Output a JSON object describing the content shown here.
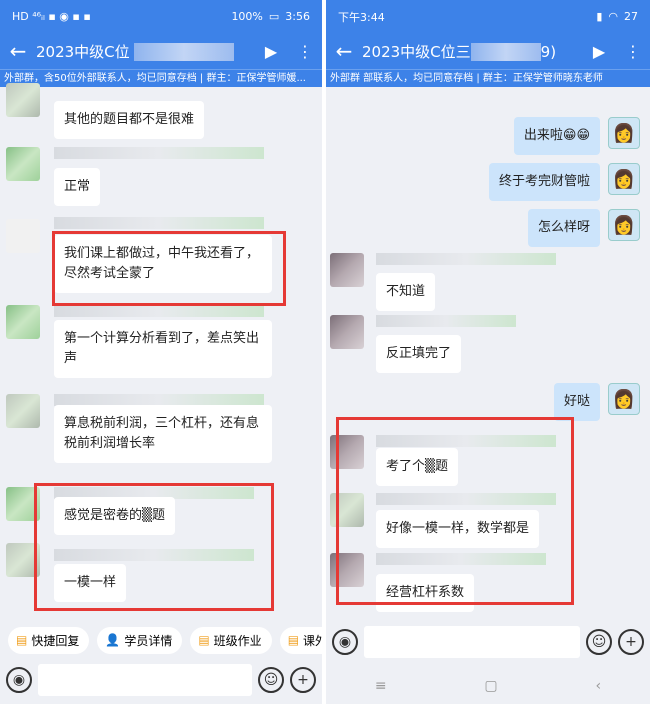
{
  "left": {
    "status": {
      "left_icons": "HD ⁴⁶ᵢₗ ▪ ◉ ▪ ▪",
      "battery": "100%",
      "time": "3:56"
    },
    "title": "2023中级C位",
    "subbar": "外部群，含50位外部联系人，均已同意存档 | 群主：正保学管师媛...",
    "messages": [
      {
        "text": "其他的题目都不是很难"
      },
      {
        "text": "正常"
      },
      {
        "text": "我们课上都做过，中午我还看了，尽然考试全蒙了"
      },
      {
        "text": "第一个计算分析看到了，差点笑出声"
      },
      {
        "text": "算息税前利润，三个杠杆，还有息税前利润增长率"
      },
      {
        "text": "感觉是密卷的▒题"
      },
      {
        "text": "一模一样"
      }
    ],
    "quick": [
      {
        "icon": "▤",
        "label": "快捷回复"
      },
      {
        "icon": "👤",
        "label": "学员详情"
      },
      {
        "icon": "▤",
        "label": "班级作业"
      },
      {
        "icon": "▤",
        "label": "课外"
      }
    ]
  },
  "right": {
    "status": {
      "time": "下午3:44",
      "battery": "27"
    },
    "title": "2023中级C位三",
    "title_suffix": "9)",
    "subbar": "外部群             部联系人，均已同意存档 | 群主：正保学管师晓东老师",
    "me_messages": [
      {
        "text": "出来啦😁😁"
      },
      {
        "text": "终于考完财管啦"
      },
      {
        "text": "怎么样呀"
      },
      {
        "text": "好哒"
      }
    ],
    "other_messages": [
      {
        "text": "不知道"
      },
      {
        "text": "反正填完了"
      },
      {
        "text": "考了个▒题"
      },
      {
        "text": "好像一模一样，数学都是"
      },
      {
        "text": "经营杠杆系数"
      }
    ],
    "nav": {
      "menu": "≡",
      "home": "▢",
      "back": "‹"
    }
  }
}
